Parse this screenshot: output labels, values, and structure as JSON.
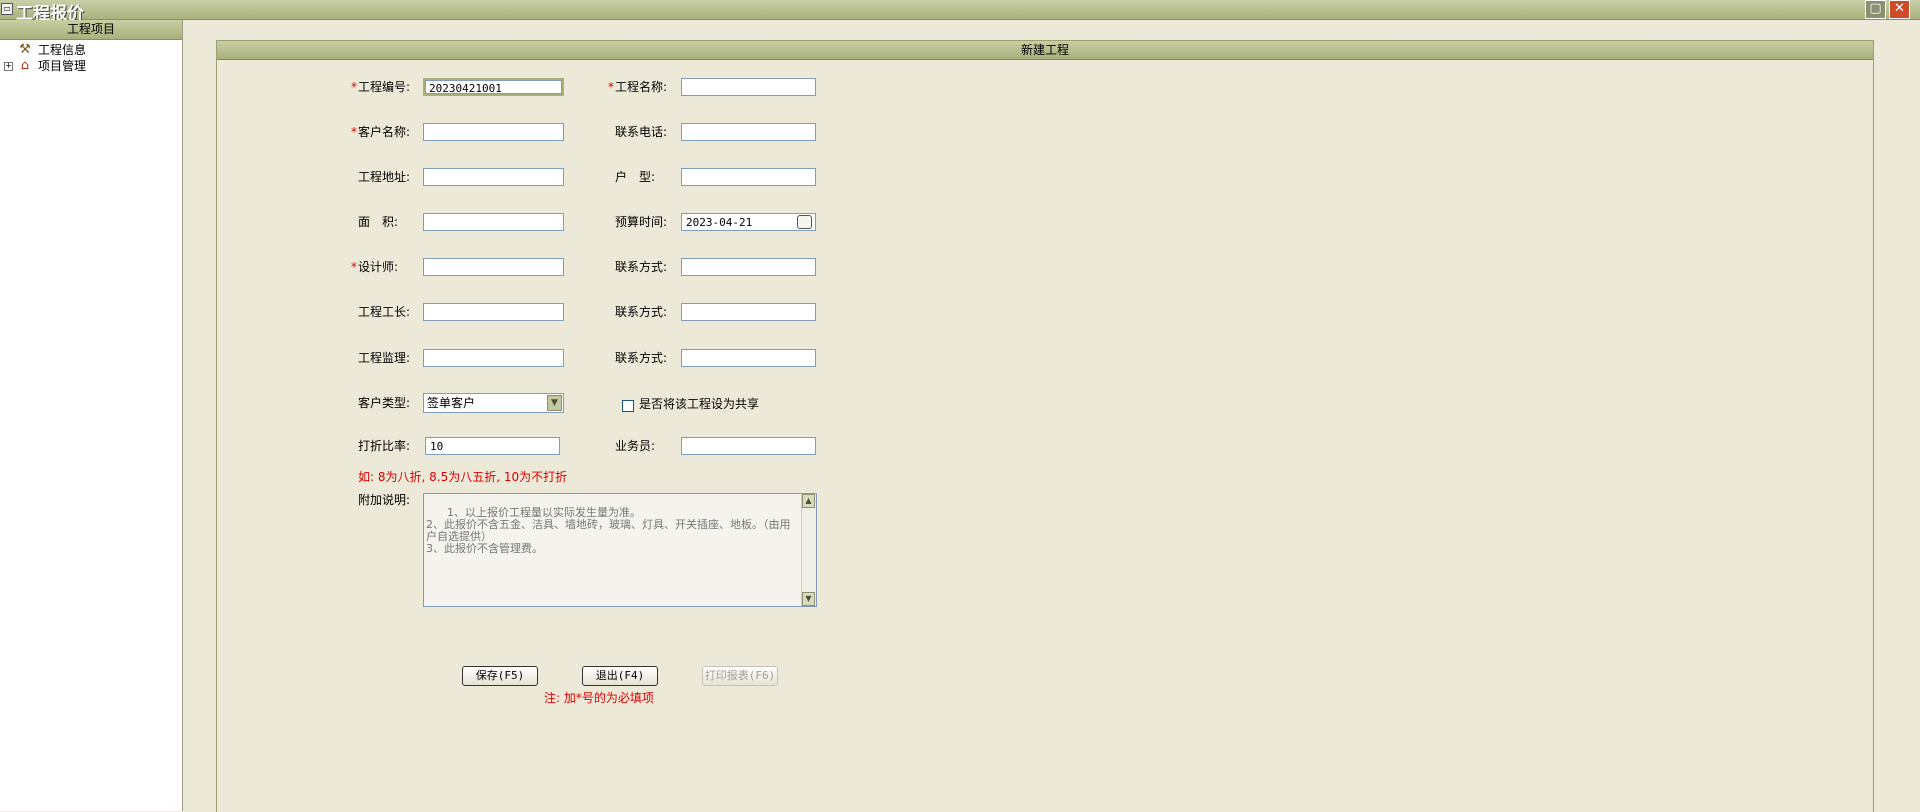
{
  "window": {
    "title": "工程报价",
    "icon": "system-menu-icon",
    "max_icon": "maximize-icon",
    "close_icon": "close-icon"
  },
  "sidebar": {
    "header": "工程项目",
    "items": [
      {
        "label": "工程信息",
        "icon": "hammer-icon",
        "expander": ""
      },
      {
        "label": "项目管理",
        "icon": "house-icon",
        "expander": "+"
      }
    ]
  },
  "panel": {
    "title": "新建工程"
  },
  "form": {
    "project_no": {
      "label": "工程编号:",
      "value": "20230421001"
    },
    "project_name": {
      "label": "工程名称:",
      "value": ""
    },
    "customer_name": {
      "label": "客户名称:",
      "value": ""
    },
    "contact_phone": {
      "label": "联系电话:",
      "value": ""
    },
    "project_address": {
      "label": "工程地址:",
      "value": ""
    },
    "house_type": {
      "label": "户　型:",
      "value": ""
    },
    "area": {
      "label": "面　积:",
      "value": ""
    },
    "budget_time": {
      "label": "预算时间:",
      "value": "2023-04-21"
    },
    "designer": {
      "label": "设计师:",
      "value": ""
    },
    "designer_contact": {
      "label": "联系方式:",
      "value": ""
    },
    "foreman": {
      "label": "工程工长:",
      "value": ""
    },
    "foreman_contact": {
      "label": "联系方式:",
      "value": ""
    },
    "supervisor": {
      "label": "工程监理:",
      "value": ""
    },
    "supervisor_contact": {
      "label": "联系方式:",
      "value": ""
    },
    "customer_type": {
      "label": "客户类型:",
      "value": "签单客户"
    },
    "share_checkbox": {
      "label": "是否将该工程设为共享",
      "checked": false
    },
    "discount": {
      "label": "打折比率:",
      "value": "10"
    },
    "salesman": {
      "label": "业务员:",
      "value": ""
    },
    "discount_hint": "如: 8为八折, 8.5为八五折, 10为不打折",
    "remarks": {
      "label": "附加说明:",
      "value": "1、以上报价工程量以实际发生量为准。\n2、此报价不含五金、洁具、墙地砖，玻璃、灯具、开关插座、地板。（由用户自选提供）\n3、此报价不含管理费。"
    }
  },
  "buttons": {
    "save": "保存(F5)",
    "exit": "退出(F4)",
    "print": "打印报表(F6)"
  },
  "footer_note": "注: 加*号的为必填项",
  "required_mark": "*",
  "colors": {
    "accent": "#a8b07c",
    "required": "#e00000",
    "background": "#ece9d8"
  }
}
